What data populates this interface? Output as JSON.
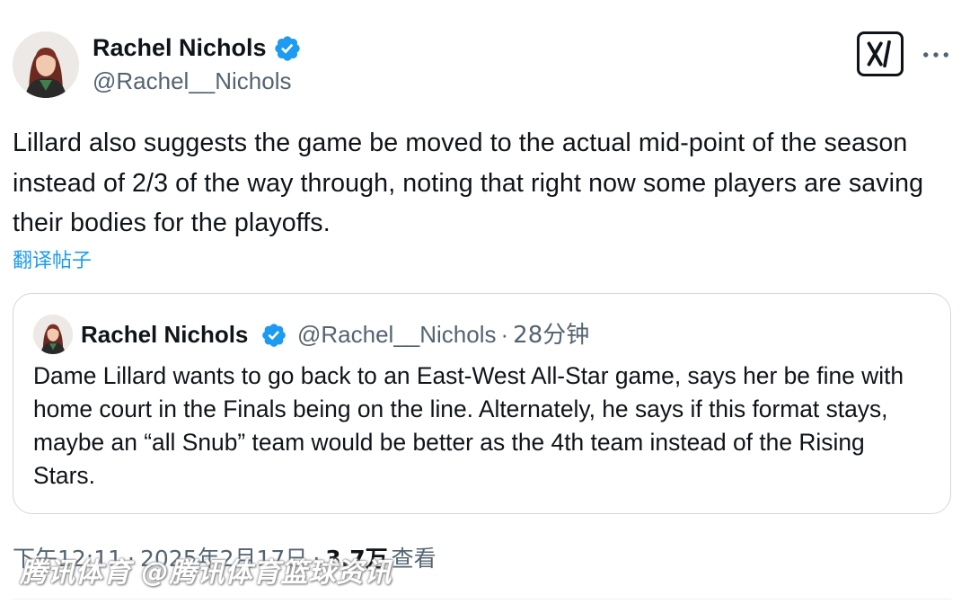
{
  "author": {
    "name": "Rachel Nichols",
    "handle": "@Rachel__Nichols",
    "verified": true
  },
  "tweet": {
    "text": "Lillard also suggests the game be moved to the actual mid-point of the season instead of 2/3 of the way through, noting that right now some players are saving their bodies for the playoffs.",
    "translate_label": "翻译帖子"
  },
  "quote": {
    "name": "Rachel Nichols",
    "handle": "@Rachel__Nichols",
    "separator": "·",
    "time": "28分钟",
    "text": "Dame Lillard wants to go back to an East-West All-Star game, says her be fine with home court in the Finals being on the line. Alternately, he says if this format stays, maybe an “all Snub” team would be better as the 4th team instead of the Rising Stars."
  },
  "meta": {
    "time": "下午12:11",
    "separator": "·",
    "date": "2025年2月17日",
    "views_count": "3.7万",
    "views_label": "查看"
  },
  "watermark": "腾讯体育 @腾讯体育篮球资讯",
  "icons": {
    "verified": "verified-badge-icon",
    "grok": "grok-icon",
    "more": "more-icon"
  },
  "colors": {
    "accent": "#1d9bf0",
    "text": "#0f1419",
    "secondary": "#536471",
    "border": "#cfd9de"
  }
}
